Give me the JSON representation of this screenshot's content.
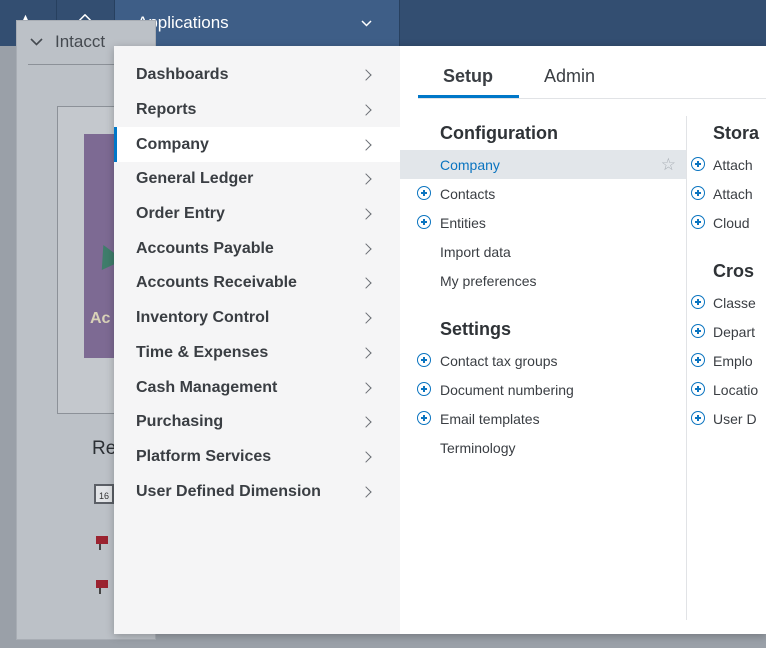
{
  "topbar": {
    "favorites_icon": "star-icon",
    "home_icon": "home-icon",
    "apps_label": "Applications",
    "apps_chevron": "chevron-down-icon",
    "color": "#334e71"
  },
  "background": {
    "card_title": "Intacct",
    "image_text": "Ac",
    "section_label": "Re",
    "calendar_day": "16"
  },
  "menu": {
    "categories": [
      {
        "label": "Dashboards"
      },
      {
        "label": "Reports"
      },
      {
        "label": "Company",
        "active": true
      },
      {
        "label": "General Ledger"
      },
      {
        "label": "Order Entry"
      },
      {
        "label": "Accounts Payable"
      },
      {
        "label": "Accounts Receivable"
      },
      {
        "label": "Inventory Control"
      },
      {
        "label": "Time & Expenses"
      },
      {
        "label": "Cash Management"
      },
      {
        "label": "Purchasing"
      },
      {
        "label": "Platform Services"
      },
      {
        "label": "User Defined Dimension"
      }
    ],
    "tabs": {
      "setup": "Setup",
      "admin": "Admin",
      "active": "Setup"
    },
    "configuration": {
      "heading": "Configuration",
      "items": [
        {
          "label": "Company",
          "selected": true,
          "plus": false
        },
        {
          "label": "Contacts",
          "plus": true
        },
        {
          "label": "Entities",
          "plus": true
        },
        {
          "label": "Import data",
          "plus": false
        },
        {
          "label": "My preferences",
          "plus": false
        }
      ]
    },
    "settings": {
      "heading": "Settings",
      "items": [
        {
          "label": "Contact tax groups",
          "plus": true
        },
        {
          "label": "Document numbering",
          "plus": true
        },
        {
          "label": "Email templates",
          "plus": true
        },
        {
          "label": "Terminology",
          "plus": false
        }
      ]
    },
    "storage": {
      "heading": "Stora",
      "items": [
        "Attach",
        "Attach",
        "Cloud"
      ]
    },
    "cross": {
      "heading": "Cros",
      "items": [
        "Classe",
        "Depart",
        "Emplo",
        "Locatio",
        "User D"
      ]
    },
    "accent_color": "#0077c8"
  }
}
